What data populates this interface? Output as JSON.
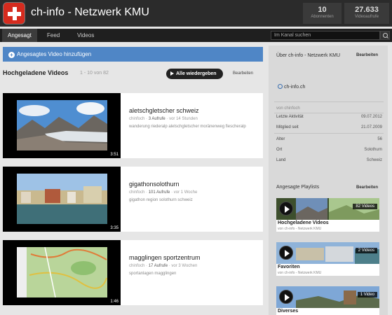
{
  "header": {
    "channel_title": "ch-info - Netzwerk KMU",
    "stats": [
      {
        "value": "10",
        "label": "Abonnenten"
      },
      {
        "value": "27.633",
        "label": "Videoaufrufe"
      }
    ]
  },
  "nav": {
    "tabs": [
      {
        "label": "Angesagt",
        "active": true
      },
      {
        "label": "Feed",
        "active": false
      },
      {
        "label": "Videos",
        "active": false
      }
    ],
    "search_placeholder": "Im Kanal suchen"
  },
  "main": {
    "add_featured_label": "Angesagtes Video hinzufügen",
    "section_title": "Hochgeladene Videos",
    "section_count": "1 - 10 von 82",
    "play_all_label": "Alle wiedergeben",
    "edit_label": "Bearbeiten",
    "videos": [
      {
        "title": "aletschgletscher schweiz",
        "author": "chinfoch",
        "views": "3 Aufrufe",
        "age": "vor 14 Stunden",
        "description": "wanderung riederalp aletschgletscher moränenweg fiescheralp",
        "duration": "3:51"
      },
      {
        "title": "gigathonsolothurn",
        "author": "chinfoch",
        "views": "101 Aufrufe",
        "age": "vor 1 Woche",
        "description": "gigathon region solothurn schweiz",
        "duration": "3:35"
      },
      {
        "title": "magglingen sportzentrum",
        "author": "chinfoch",
        "views": "17 Aufrufe",
        "age": "vor 3 Wochen",
        "description": "sportanlagen magglingen",
        "duration": "1:46"
      }
    ]
  },
  "sidebar": {
    "about_title": "Über ch-info - Netzwerk KMU",
    "about_edit": "Bearbeiten",
    "website": "ch-info.ch",
    "from_label": "von chinfoch",
    "info": [
      {
        "key": "Letzte Aktivität",
        "value": "09.07.2012"
      },
      {
        "key": "Mitglied seit",
        "value": "21.07.2009"
      },
      {
        "key": "Alter",
        "value": "56"
      },
      {
        "key": "Ort",
        "value": "Solothurn"
      },
      {
        "key": "Land",
        "value": "Schweiz"
      }
    ],
    "playlists_title": "Angesagte Playlists",
    "playlists_edit": "Bearbeiten",
    "playlists": [
      {
        "name": "Hochgeladene Videos",
        "by": "von ch-info - Netzwerk KMU",
        "count": "82 Videos"
      },
      {
        "name": "Favoriten",
        "by": "von ch-info - Netzwerk KMU",
        "count": "2 Videos"
      },
      {
        "name": "Diverses",
        "by": "",
        "count": "1 Video"
      }
    ]
  }
}
